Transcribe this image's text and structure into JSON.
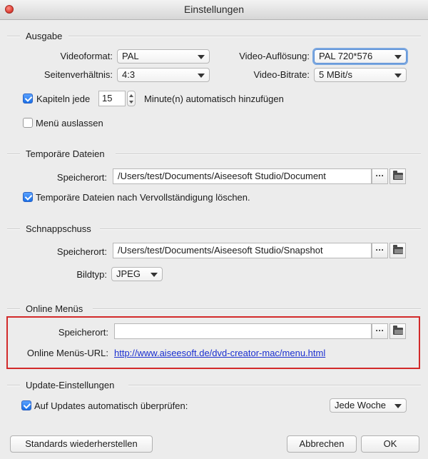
{
  "window": {
    "title": "Einstellungen"
  },
  "ausgabe": {
    "title": "Ausgabe",
    "videoformat_label": "Videoformat:",
    "videoformat_value": "PAL",
    "aufloesung_label": "Video-Auflösung:",
    "aufloesung_value": "PAL 720*576",
    "seitenverhaeltnis_label": "Seitenverhältnis:",
    "seitenverhaeltnis_value": "4:3",
    "bitrate_label": "Video-Bitrate:",
    "bitrate_value": "5 MBit/s",
    "kapiteln_label": "Kapiteln jede",
    "kapiteln_value": "15",
    "kapiteln_suffix": "Minute(n) automatisch hinzufügen",
    "kapiteln_checked": true,
    "menue_label": "Menü auslassen",
    "menue_checked": false
  },
  "temp": {
    "title": "Temporäre Dateien",
    "speicherort_label": "Speicherort:",
    "speicherort_value": "/Users/test/Documents/Aiseesoft Studio/Document",
    "loeschen_label": "Temporäre Dateien nach Vervollständigung löschen.",
    "loeschen_checked": true
  },
  "snapshot": {
    "title": "Schnappschuss",
    "speicherort_label": "Speicherort:",
    "speicherort_value": "/Users/test/Documents/Aiseesoft Studio/Snapshot",
    "bildtyp_label": "Bildtyp:",
    "bildtyp_value": "JPEG"
  },
  "online": {
    "title": "Online Menüs",
    "speicherort_label": "Speicherort:",
    "speicherort_value": "",
    "url_label": "Online Menüs-URL:",
    "url_value": "http://www.aiseesoft.de/dvd-creator-mac/menu.html"
  },
  "update": {
    "title": "Update-Einstellungen",
    "auto_label": "Auf Updates automatisch überprüfen:",
    "auto_checked": true,
    "frequency_value": "Jede Woche"
  },
  "buttons": {
    "ellipsis": "···",
    "standards": "Standards wiederherstellen",
    "abbrechen": "Abbrechen",
    "ok": "OK"
  },
  "colors": {
    "highlight": "#d22a2a",
    "link": "#1a2fd0",
    "checkbox_accent": "#1a6fe6"
  }
}
